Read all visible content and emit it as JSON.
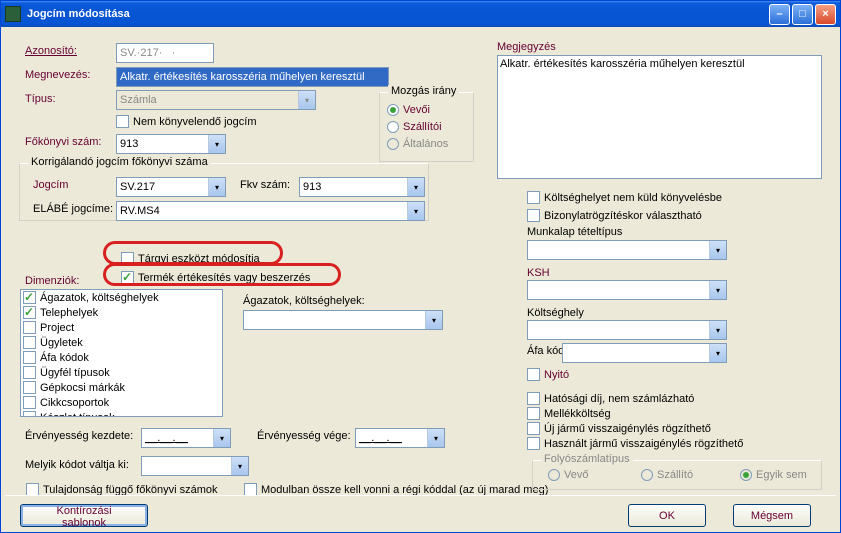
{
  "window": {
    "title": "Jogcím módosítása"
  },
  "left": {
    "azonosito_lbl": "Azonosító:",
    "azonosito_val": "SV.·217·   ·",
    "megnevezes_lbl": "Megnevezés:",
    "megnevezes_val": "Alkatr. értékesítés karosszéria műhelyen keresztül",
    "tipus_lbl": "Típus:",
    "tipus_val": "Számla",
    "nem_konyv": "Nem könyvelendő jogcím",
    "fokonyvi_lbl": "Főkönyvi szám:",
    "fokonyvi_val": "913",
    "korig_title": "Korrigálandó jogcím főkönyvi száma",
    "jogcim_lbl": "Jogcím",
    "jogcim_val": "SV.217",
    "fkvszam_lbl": "Fkv szám:",
    "fkvszam_val": "913",
    "elabe_lbl": "ELÁBÉ jogcíme:",
    "elabe_val": "RV.MS4",
    "targyi": "Tárgyi eszközt módosítja",
    "termek": "Termék értékesítés vagy beszerzés",
    "dimenziok_lbl": "Dimenziók:",
    "dimenziok": [
      {
        "label": "Ágazatok, költséghelyek",
        "checked": true
      },
      {
        "label": "Telephelyek",
        "checked": true
      },
      {
        "label": "Project",
        "checked": false
      },
      {
        "label": "Ügyletek",
        "checked": false
      },
      {
        "label": "Áfa kódok",
        "checked": false
      },
      {
        "label": "Ügyfél típusok",
        "checked": false
      },
      {
        "label": "Gépkocsi márkák",
        "checked": false
      },
      {
        "label": "Cikkcsoportok",
        "checked": false
      },
      {
        "label": "Készlet típusok",
        "checked": false
      }
    ],
    "agazatok_lbl": "Ágazatok, költséghelyek:",
    "erv_kezdete_lbl": "Érvényesség kezdete:",
    "erv_kezdete_val": "__.__.__",
    "erv_vege_lbl": "Érvényesség vége:",
    "erv_vege_val": "__.__.__",
    "melyik_lbl": "Melyik kódot váltja ki:",
    "tulajdonsag": "Tulajdonság függő főkönyvi számok",
    "modulban": "Modulban össze kell vonni a régi kóddal (az új marad meg)"
  },
  "mozgas": {
    "title": "Mozgás irány",
    "vevoi": "Vevői",
    "szallitoi": "Szállítói",
    "altalanos": "Általános"
  },
  "right": {
    "megjegyzes_lbl": "Megjegyzés",
    "megjegyzes_val": "Alkatr. értékesítés karosszéria műhelyen keresztül",
    "ktg_nem_kuld": "Költséghelyet nem küld könyvelésbe",
    "biz_valaszthato": "Bizonylatrögzítéskor választható",
    "munkalap_lbl": "Munkalap tételtípus",
    "ksh_lbl": "KSH",
    "koltseghely_lbl": "Költséghely",
    "afakod_lbl": "Áfa kód",
    "nyito": "Nyitó",
    "hatosagi": "Hatósági díj, nem számlázható",
    "mellekktg": "Mellékköltség",
    "uj_jarmu": "Új jármű visszaigénylés rögzíthető",
    "hasznalt": "Használt jármű visszaigénylés rögzíthető",
    "folyo_title": "Folyószámlatípus",
    "folyo_vevo": "Vevő",
    "folyo_szallito": "Szállító",
    "folyo_egyik": "Egyik sem"
  },
  "buttons": {
    "kontirozasi": "Kontírozási sablonok",
    "ok": "OK",
    "megsem": "Mégsem"
  }
}
